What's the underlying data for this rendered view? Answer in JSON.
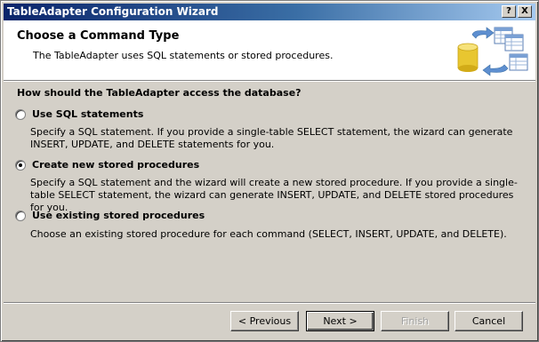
{
  "window": {
    "title": "TableAdapter Configuration Wizard",
    "help_label": "?",
    "close_label": "X"
  },
  "header": {
    "title": "Choose a Command Type",
    "subtitle": "The TableAdapter uses SQL statements or stored procedures.",
    "icon": "database-tables-wizard-icon"
  },
  "question": "How should the TableAdapter access the database?",
  "options": [
    {
      "label": "Use SQL statements",
      "description": "Specify a SQL statement. If you provide a single-table SELECT statement, the wizard can generate INSERT, UPDATE, and DELETE statements for you.",
      "selected": false
    },
    {
      "label": "Create new stored procedures",
      "description": "Specify a SQL statement and the wizard will create a new stored procedure. If you provide a single-table SELECT statement, the wizard can generate INSERT, UPDATE, and DELETE stored procedures for you.",
      "selected": true
    },
    {
      "label": "Use existing stored procedures",
      "description": "Choose an existing stored procedure for each command (SELECT, INSERT, UPDATE, and DELETE).",
      "selected": false
    }
  ],
  "buttons": {
    "previous": "< Previous",
    "next": "Next >",
    "finish": "Finish",
    "cancel": "Cancel"
  },
  "colors": {
    "titlebar_start": "#0a246a",
    "titlebar_end": "#a6caf0",
    "dialog_bg": "#d4d0c8",
    "header_bg": "#ffffff"
  }
}
